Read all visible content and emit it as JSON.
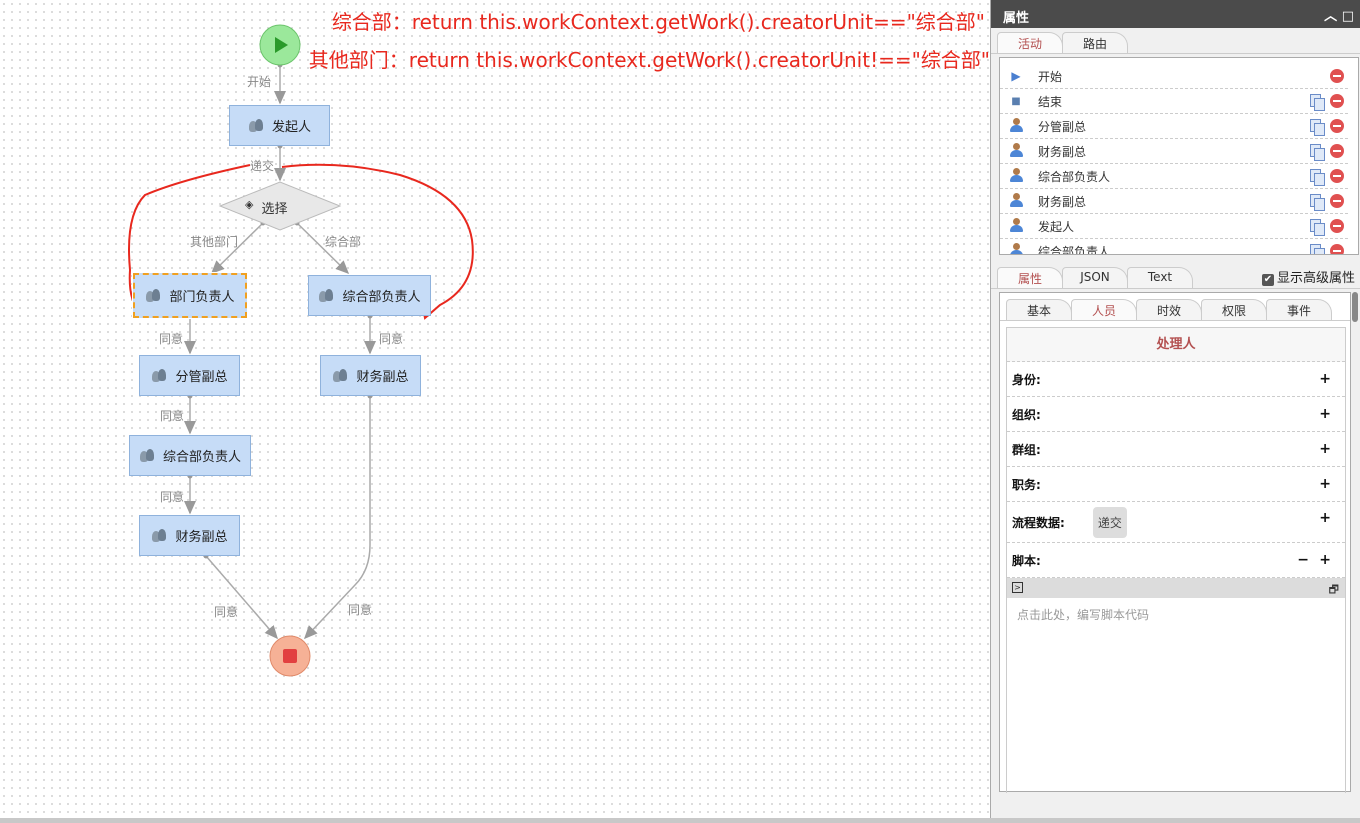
{
  "annotations": [
    "综合部：return this.workContext.getWork().creatorUnit==\"综合部\"",
    "其他部门：return this.workContext.getWork().creatorUnit!==\"综合部\""
  ],
  "flow": {
    "nodes": {
      "start": "开始",
      "initiator": "发起人",
      "choice": "选择",
      "dept_head": "部门负责人",
      "general_head_right": "综合部负责人",
      "vp": "分管副总",
      "finance_right": "财务副总",
      "general_head_left": "综合部负责人",
      "finance_left": "财务副总"
    },
    "routes": {
      "start": "开始",
      "submit": "递交",
      "other": "其他部门",
      "general": "综合部",
      "agree1": "同意",
      "agree2": "同意",
      "agree3": "同意",
      "agree4": "同意",
      "agree5": "同意",
      "agree6": "同意"
    }
  },
  "panel": {
    "title": "属性",
    "top_tabs": [
      "活动",
      "路由"
    ],
    "activities": [
      {
        "name": "开始",
        "icon": "play-icon"
      },
      {
        "name": "结束",
        "icon": "stop-icon"
      },
      {
        "name": "分管副总",
        "icon": "person-icon"
      },
      {
        "name": "财务副总",
        "icon": "person-icon"
      },
      {
        "name": "综合部负责人",
        "icon": "person-icon"
      },
      {
        "name": "财务副总",
        "icon": "person-icon"
      },
      {
        "name": "发起人",
        "icon": "person-icon"
      },
      {
        "name": "综合部负责人",
        "icon": "person-icon"
      }
    ],
    "prop_tabs": [
      "属性",
      "JSON",
      "Text"
    ],
    "show_advanced": "显示高级属性",
    "sub_tabs": [
      "基本",
      "人员",
      "时效",
      "权限",
      "事件"
    ],
    "section_title": "处理人",
    "fields": {
      "identity": "身份:",
      "org": "组织:",
      "group": "群组:",
      "duty": "职务:",
      "process_data": "流程数据:",
      "script": "脚本:"
    },
    "process_data_chip": "递交",
    "script_placeholder": "点击此处，编写脚本代码"
  },
  "colors": {
    "accent": "#b35050",
    "annotation": "#e8281e",
    "node": "#c6dcf7"
  }
}
